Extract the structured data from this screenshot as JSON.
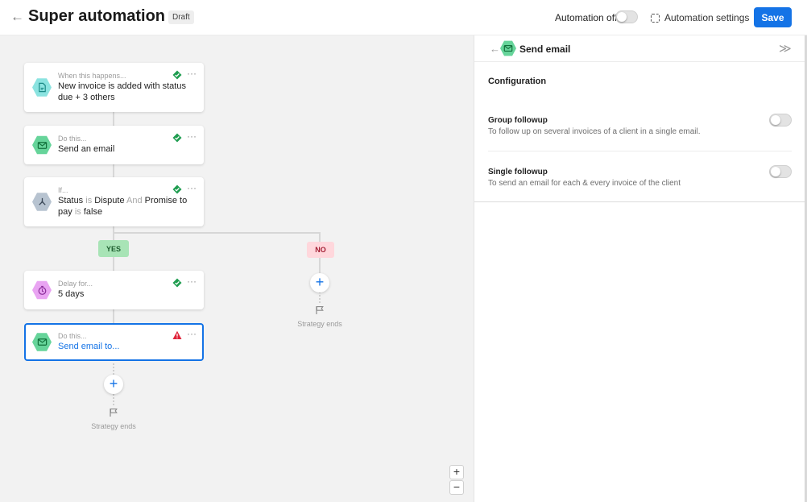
{
  "header": {
    "title": "Super automation",
    "status_badge": "Draft",
    "automation_toggle_label": "Automation off",
    "automation_enabled": false,
    "settings_label": "Automation settings",
    "save_label": "Save",
    "accent_color": "#1473e6"
  },
  "flow": {
    "trigger": {
      "kicker": "When this happens...",
      "text": "New invoice is added with status due + 3 others",
      "icon": "invoice-icon",
      "valid": true
    },
    "action1": {
      "kicker": "Do this...",
      "text": "Send an email",
      "icon": "email-icon",
      "valid": true
    },
    "condition": {
      "kicker": "If...",
      "parts": {
        "field1": "Status",
        "op1": "is",
        "value1": "Dispute",
        "conj": "And",
        "field2": "Promise to pay",
        "op2": "is",
        "value2": "false"
      },
      "icon": "branch-icon",
      "valid": true
    },
    "yes_label": "YES",
    "no_label": "NO",
    "delay": {
      "kicker": "Delay for...",
      "text": "5 days",
      "icon": "timer-icon",
      "valid": true
    },
    "action2": {
      "kicker": "Do this...",
      "text": "Send email to...",
      "icon": "email-icon",
      "valid": false
    },
    "add_step_symbol": "+",
    "strategy_ends": "Strategy ends",
    "more_symbol": "···"
  },
  "zoom": {
    "in": "+",
    "out": "−"
  },
  "panel": {
    "title": "Send email",
    "back_symbol": "←",
    "collapse_symbol": "≫",
    "section": "Configuration",
    "options": [
      {
        "title": "Group followup",
        "description": "To follow up on several invoices of a client in a single email.",
        "enabled": false
      },
      {
        "title": "Single followup",
        "description": "To send an email for each & every invoice of the client",
        "enabled": false
      }
    ]
  }
}
